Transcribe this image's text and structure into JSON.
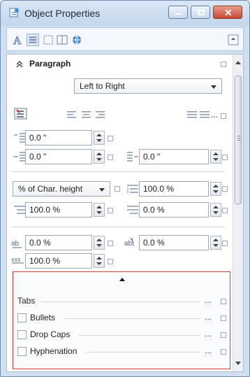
{
  "window": {
    "title": "Object Properties",
    "icons": {
      "app": "object-properties-icon",
      "minimize": "minimize-icon",
      "maximize": "maximize-icon",
      "close": "close-icon"
    }
  },
  "toolbar": {
    "icons": [
      "text-icon",
      "paragraph-icon",
      "frame-icon",
      "columns-icon",
      "globe-icon",
      "options-icon"
    ]
  },
  "paragraph": {
    "title": "Paragraph",
    "direction": "Left to Right",
    "alignment_icons": [
      "align-left-icon",
      "align-center-icon",
      "align-right-icon",
      "justify-icon",
      "force-justify-icon",
      "more-options-icon"
    ],
    "indent_top": "0.0 \"",
    "indent_left": "0.0 \"",
    "indent_right": "0.0 \"",
    "spacing_unit": "% of Char. height",
    "line_spacing": "100.0 %",
    "before_paragraph": "100.0 %",
    "after_paragraph": "0.0 %",
    "char_spacing_left": "0.0 %",
    "char_spacing_right": "0.0 %",
    "word_spacing": "100.0 %"
  },
  "expanded": {
    "tabs": "Tabs",
    "bullets": "Bullets",
    "drop_caps": "Drop Caps",
    "hyphenation": "Hyphenation",
    "dots": "..."
  }
}
